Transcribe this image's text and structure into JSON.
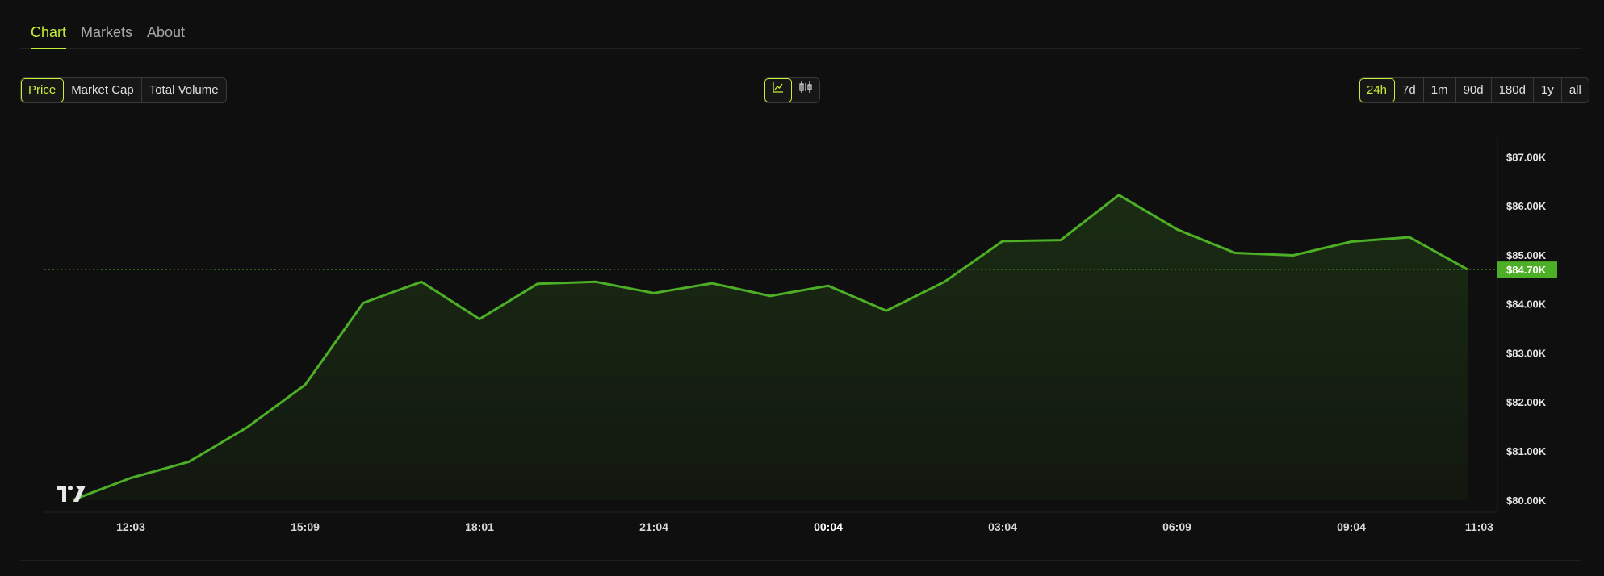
{
  "tabs": [
    {
      "label": "Chart",
      "active": true
    },
    {
      "label": "Markets",
      "active": false
    },
    {
      "label": "About",
      "active": false
    }
  ],
  "metric_buttons": [
    {
      "label": "Price",
      "active": true
    },
    {
      "label": "Market Cap",
      "active": false
    },
    {
      "label": "Total Volume",
      "active": false
    }
  ],
  "chart_type_buttons": [
    {
      "icon": "line-chart-icon",
      "active": true
    },
    {
      "icon": "candlestick-chart-icon",
      "active": false
    }
  ],
  "range_buttons": [
    {
      "label": "24h",
      "active": true
    },
    {
      "label": "7d",
      "active": false
    },
    {
      "label": "1m",
      "active": false
    },
    {
      "label": "90d",
      "active": false
    },
    {
      "label": "180d",
      "active": false
    },
    {
      "label": "1y",
      "active": false
    },
    {
      "label": "all",
      "active": false
    }
  ],
  "colors": {
    "accent": "#c6f036",
    "series": "#4caf25",
    "background": "#0f0f0f"
  },
  "chart_data": {
    "type": "area",
    "x_ticks": [
      "12:03",
      "15:09",
      "18:01",
      "21:04",
      "00:04",
      "03:04",
      "06:09",
      "09:04",
      "11:03"
    ],
    "x_tick_index": [
      1,
      4,
      7,
      10,
      13,
      16,
      19,
      22,
      24.2
    ],
    "bold_tick": "00:04",
    "y_ticks": [
      {
        "value": 80000,
        "label": "$80.00K"
      },
      {
        "value": 81000,
        "label": "$81.00K"
      },
      {
        "value": 82000,
        "label": "$82.00K"
      },
      {
        "value": 83000,
        "label": "$83.00K"
      },
      {
        "value": 84000,
        "label": "$84.00K"
      },
      {
        "value": 85000,
        "label": "$85.00K"
      },
      {
        "value": 86000,
        "label": "$86.00K"
      },
      {
        "value": 87000,
        "label": "$87.00K"
      }
    ],
    "ylim": [
      79750,
      87400
    ],
    "values": [
      80000,
      80450,
      80780,
      81480,
      82350,
      84020,
      84450,
      83690,
      84410,
      84450,
      84220,
      84420,
      84160,
      84370,
      83860,
      84450,
      85280,
      85300,
      86220,
      85520,
      85040,
      84990,
      85270,
      85360,
      84700
    ],
    "current_value": 84700,
    "current_label": "$84.70K",
    "grid": false,
    "legend": "none",
    "watermark": "TV"
  }
}
